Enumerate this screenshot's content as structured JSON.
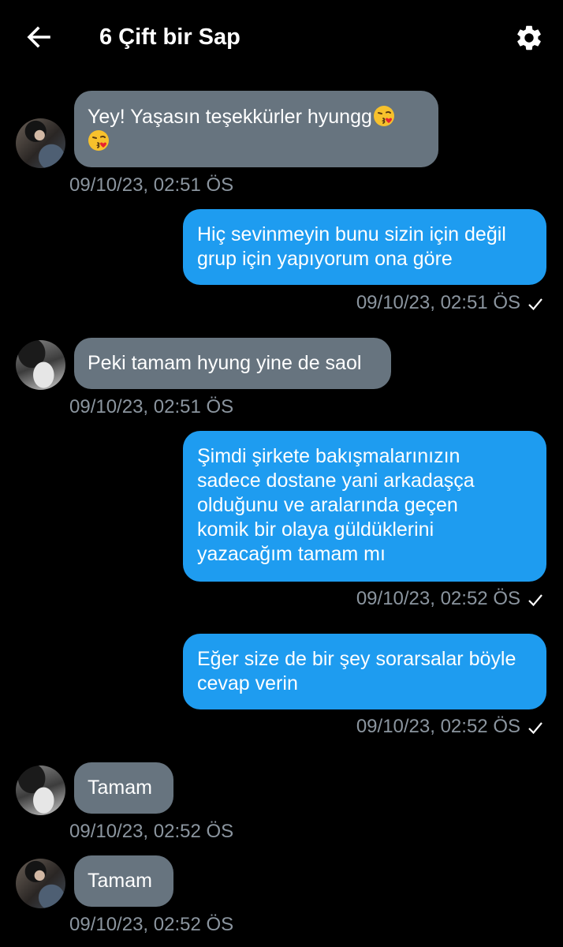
{
  "header": {
    "title": "6 Çift bir Sap"
  },
  "messages": [
    {
      "direction": "incoming",
      "avatar": "avatar-boy-dark",
      "lines": [
        "Yey! Yaşasın teşekkürler hyungg",
        ""
      ],
      "emojis": [
        "face-blowing-kiss-emoji",
        "face-blowing-kiss-emoji"
      ],
      "time": "09/10/23, 02:51 ÖS"
    },
    {
      "direction": "outgoing",
      "lines": [
        "Hiç sevinmeyin bunu sizin için değil",
        "grup için yapıyorum ona göre"
      ],
      "time": "09/10/23, 02:51 ÖS",
      "status": "check-icon"
    },
    {
      "direction": "incoming",
      "avatar": "avatar-grey",
      "lines": [
        "Peki tamam hyung yine de saol"
      ],
      "time": "09/10/23, 02:51 ÖS"
    },
    {
      "direction": "outgoing",
      "lines": [
        "Şimdi şirkete bakışmalarınızın",
        "sadece dostane yani arkadaşça",
        "olduğunu ve aralarında geçen",
        "komik bir olaya güldüklerini",
        "yazacağım tamam mı"
      ],
      "time": "09/10/23, 02:52 ÖS",
      "status": "check-icon"
    },
    {
      "direction": "outgoing",
      "lines": [
        "Eğer size de bir şey sorarsalar böyle",
        "cevap verin"
      ],
      "time": "09/10/23, 02:52 ÖS",
      "status": "check-icon"
    },
    {
      "direction": "incoming",
      "avatar": "avatar-grey",
      "lines": [
        "Tamam"
      ],
      "time": "09/10/23, 02:52 ÖS"
    },
    {
      "direction": "incoming",
      "avatar": "avatar-boy-dark",
      "lines": [
        "Tamam"
      ],
      "time": "09/10/23, 02:52 ÖS"
    }
  ],
  "colors": {
    "background": "#000000",
    "incoming_bubble": "#67747f",
    "outgoing_bubble": "#1e9cf0",
    "timestamp": "#8b959f"
  }
}
